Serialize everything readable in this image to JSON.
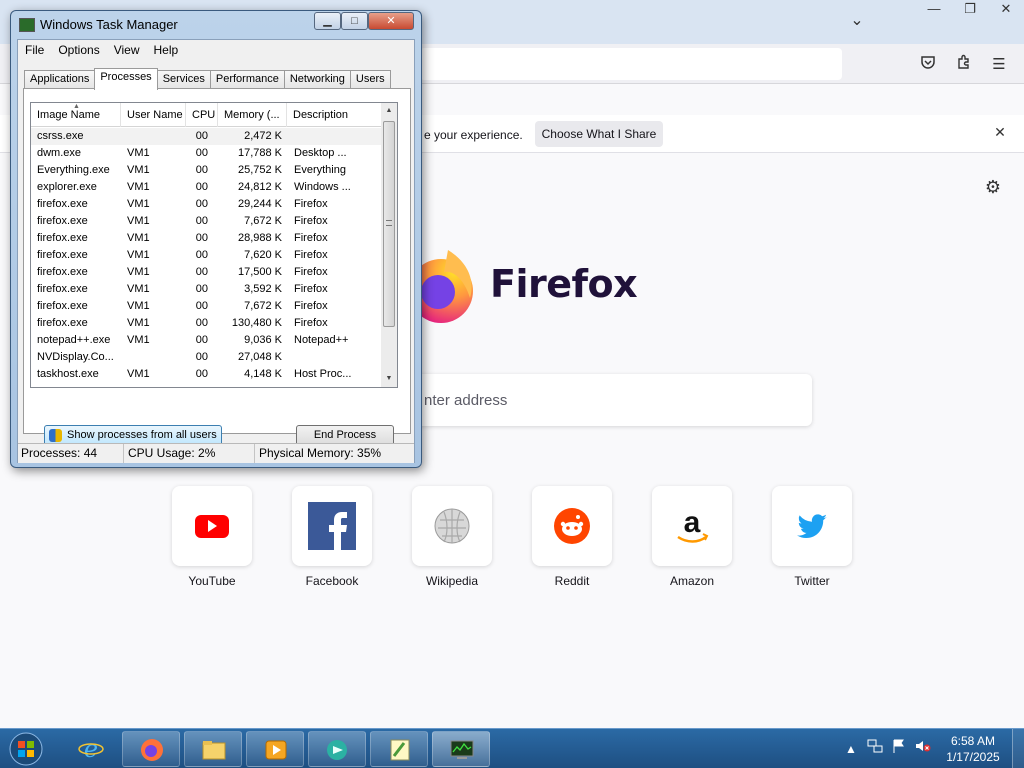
{
  "firefox": {
    "notification_text": "e your experience.",
    "notification_button": "Choose What I Share",
    "notification_close": "✕",
    "wordmark": "Firefox",
    "search_placeholder": "nter address",
    "shortcuts": [
      {
        "label": "YouTube",
        "icon": "youtube-icon",
        "color": "#ff0000"
      },
      {
        "label": "Facebook",
        "icon": "facebook-icon",
        "color": "#3b5998"
      },
      {
        "label": "Wikipedia",
        "icon": "wikipedia-icon",
        "color": "#999999"
      },
      {
        "label": "Reddit",
        "icon": "reddit-icon",
        "color": "#ff4500"
      },
      {
        "label": "Amazon",
        "icon": "amazon-icon",
        "color": "#ff9900"
      },
      {
        "label": "Twitter",
        "icon": "twitter-icon",
        "color": "#1da1f2"
      }
    ]
  },
  "taskmanager": {
    "title": "Windows Task Manager",
    "menu": [
      "File",
      "Options",
      "View",
      "Help"
    ],
    "tabs": [
      "Applications",
      "Processes",
      "Services",
      "Performance",
      "Networking",
      "Users"
    ],
    "active_tab": "Processes",
    "columns": [
      "Image Name",
      "User Name",
      "CPU",
      "Memory (...",
      "Description"
    ],
    "rows": [
      {
        "image": "csrss.exe",
        "user": "",
        "cpu": "00",
        "mem": "2,472 K",
        "desc": ""
      },
      {
        "image": "dwm.exe",
        "user": "VM1",
        "cpu": "00",
        "mem": "17,788 K",
        "desc": "Desktop ..."
      },
      {
        "image": "Everything.exe",
        "user": "VM1",
        "cpu": "00",
        "mem": "25,752 K",
        "desc": "Everything"
      },
      {
        "image": "explorer.exe",
        "user": "VM1",
        "cpu": "00",
        "mem": "24,812 K",
        "desc": "Windows ..."
      },
      {
        "image": "firefox.exe",
        "user": "VM1",
        "cpu": "00",
        "mem": "29,244 K",
        "desc": "Firefox"
      },
      {
        "image": "firefox.exe",
        "user": "VM1",
        "cpu": "00",
        "mem": "7,672 K",
        "desc": "Firefox"
      },
      {
        "image": "firefox.exe",
        "user": "VM1",
        "cpu": "00",
        "mem": "28,988 K",
        "desc": "Firefox"
      },
      {
        "image": "firefox.exe",
        "user": "VM1",
        "cpu": "00",
        "mem": "7,620 K",
        "desc": "Firefox"
      },
      {
        "image": "firefox.exe",
        "user": "VM1",
        "cpu": "00",
        "mem": "17,500 K",
        "desc": "Firefox"
      },
      {
        "image": "firefox.exe",
        "user": "VM1",
        "cpu": "00",
        "mem": "3,592 K",
        "desc": "Firefox"
      },
      {
        "image": "firefox.exe",
        "user": "VM1",
        "cpu": "00",
        "mem": "7,672 K",
        "desc": "Firefox"
      },
      {
        "image": "firefox.exe",
        "user": "VM1",
        "cpu": "00",
        "mem": "130,480 K",
        "desc": "Firefox"
      },
      {
        "image": "notepad++.exe",
        "user": "VM1",
        "cpu": "00",
        "mem": "9,036 K",
        "desc": "Notepad++"
      },
      {
        "image": "NVDisplay.Co...",
        "user": "",
        "cpu": "00",
        "mem": "27,048 K",
        "desc": ""
      },
      {
        "image": "taskhost.exe",
        "user": "VM1",
        "cpu": "00",
        "mem": "4,148 K",
        "desc": "Host Proc..."
      }
    ],
    "show_all_button": "Show processes from all users",
    "end_process_button": "End Process",
    "status": {
      "processes": "Processes: 44",
      "cpu": "CPU Usage: 2%",
      "memory": "Physical Memory: 35%"
    }
  },
  "taskbar": {
    "time": "6:58 AM",
    "date": "1/17/2025"
  }
}
